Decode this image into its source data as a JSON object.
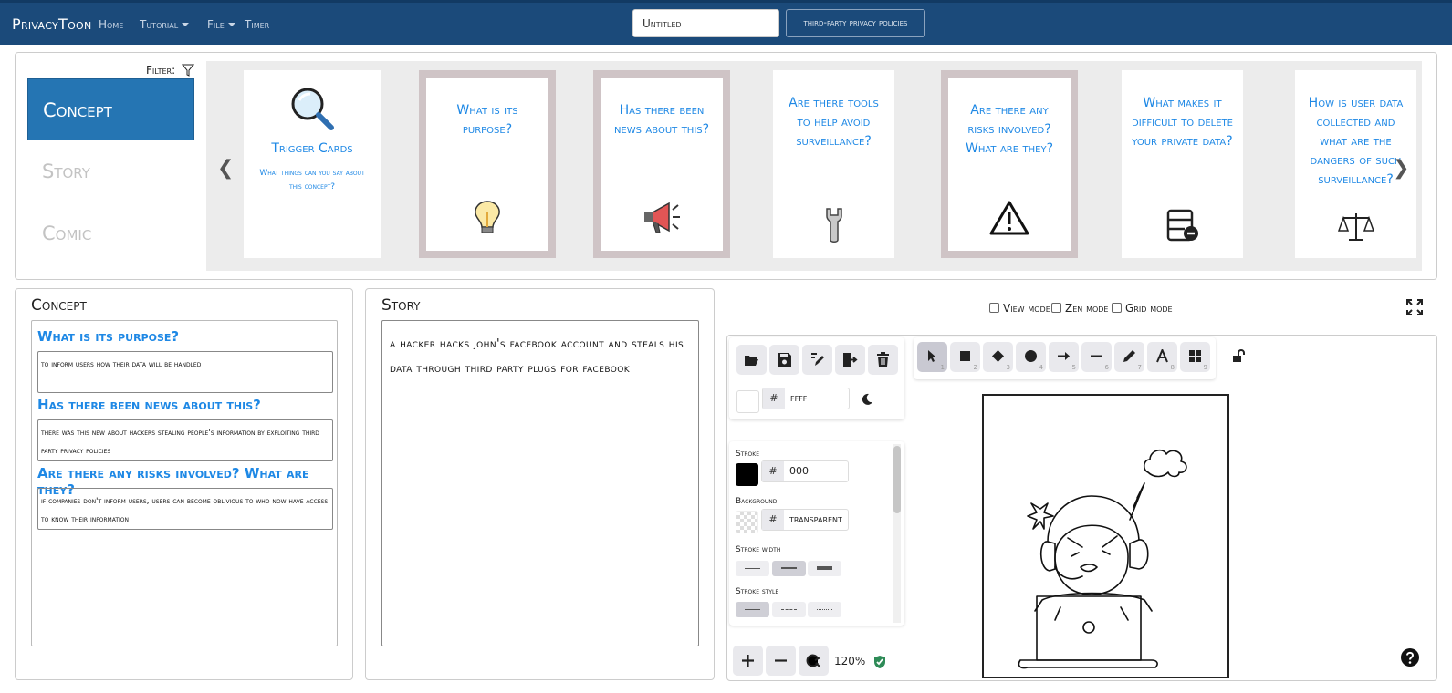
{
  "navbar": {
    "brand": "PrivacyToon",
    "links": {
      "home": "Home",
      "tutorial": "Tutorial",
      "file": "File",
      "timer": "Timer"
    },
    "title_value": "Untitled",
    "policies_button": "third-party privacy policies"
  },
  "top_panel": {
    "filter_label": "Filter:",
    "tabs": {
      "concept": "Concept",
      "story": "Story",
      "comic": "Comic"
    },
    "trigger_card": {
      "title": "Trigger Cards",
      "subtitle": "What things can you say about this concept?",
      "icon": "magnifier-icon"
    },
    "cards": [
      {
        "question": "What is its purpose?",
        "icon": "lightbulb-icon"
      },
      {
        "question": "Has there been news about this?",
        "icon": "megaphone-icon"
      },
      {
        "question": "Are there tools to help avoid surveillance?",
        "icon": "wrench-icon"
      },
      {
        "question": "Are there any risks involved? What are they?",
        "icon": "warning-icon"
      },
      {
        "question": "What makes it difficult to delete your private data?",
        "icon": "delete-data-icon"
      },
      {
        "question": "How is user data collected and what are the dangers of such surveillance?",
        "icon": "scales-icon"
      }
    ]
  },
  "concept_panel": {
    "title": "Concept",
    "items": [
      {
        "question": "What is its purpose?",
        "answer": "to inform users how their data will be handled"
      },
      {
        "question": "Has there been news about this?",
        "answer": "there was this new about hackers stealing people's information by exploiting third party privacy policies"
      },
      {
        "question": "Are there any risks involved? What are they?",
        "answer": "if companies don't inform users, users can become oblivious to who now have access to know their information"
      }
    ]
  },
  "story_panel": {
    "title": "Story",
    "text": "a hacker hacks john's facebook account and steals his data through third party plugs for facebook"
  },
  "modes": {
    "view": "View mode",
    "zen": "Zen mode",
    "grid": "Grid mode"
  },
  "canvas": {
    "canvas_bg_hex": "ffff",
    "stroke_label": "Stroke",
    "stroke_hex": "000",
    "background_label": "Background",
    "background_hex": "transparent",
    "stroke_width_label": "Stroke width",
    "stroke_style_label": "Stroke style",
    "tool_numbers": [
      "1",
      "2",
      "3",
      "4",
      "5",
      "6",
      "7",
      "8",
      "9"
    ],
    "zoom": "120%"
  },
  "colors": {
    "navbar": "#1b4a7a",
    "accent": "#2575b3",
    "question_blue": "#1e88e5",
    "card_frame": "#cfc4c6"
  }
}
